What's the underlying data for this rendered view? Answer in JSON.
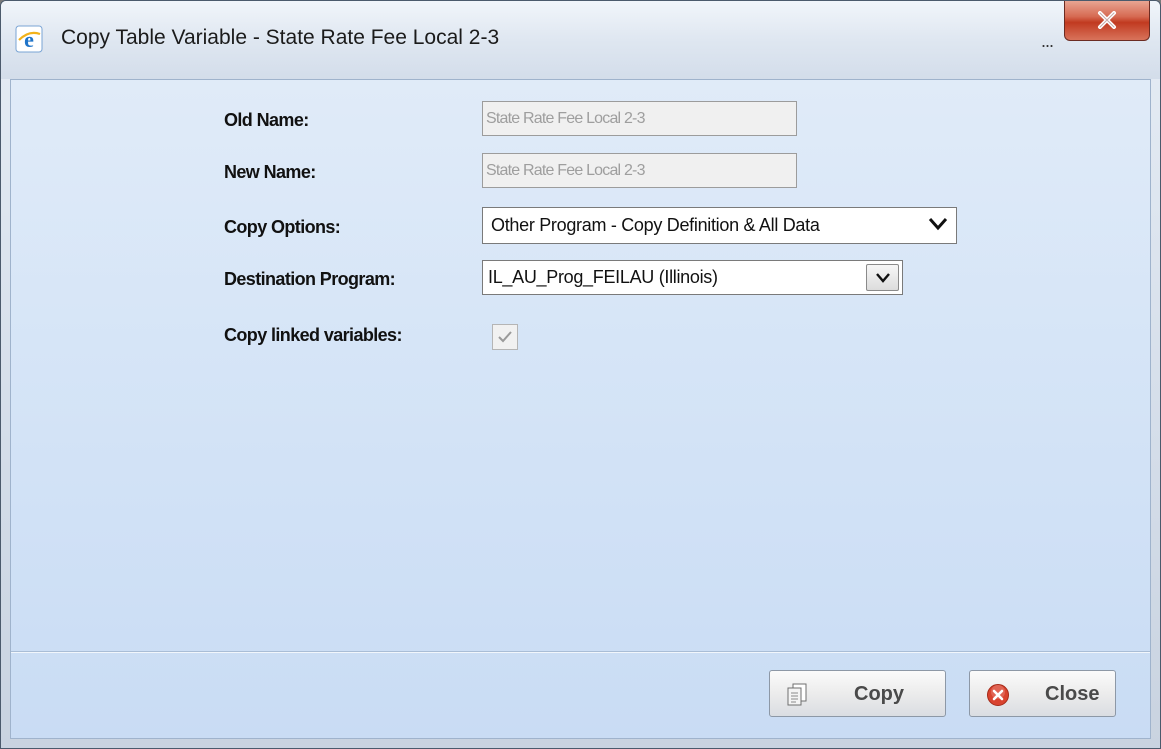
{
  "window": {
    "title": "Copy Table Variable - State Rate Fee Local 2-3",
    "ellipsis": "..."
  },
  "form": {
    "old_name": {
      "label": "Old Name:",
      "value": "State Rate Fee Local 2-3"
    },
    "new_name": {
      "label": "New Name:",
      "value": "State Rate Fee Local 2-3"
    },
    "copy_options": {
      "label": "Copy Options:",
      "selected": "Other Program - Copy Definition & All Data"
    },
    "destination_program": {
      "label": "Destination Program:",
      "selected": "IL_AU_Prog_FEILAU (Illinois)"
    },
    "copy_linked": {
      "label": "Copy linked variables:",
      "checked": true
    }
  },
  "buttons": {
    "copy_label": "Copy",
    "close_label": "Close"
  },
  "colors": {
    "close_icon_red": "#d9432f",
    "window_close_red": "#c13a20",
    "client_background": "#d6e5f7"
  },
  "icons": {
    "app": "internet-explorer-icon",
    "window_close": "close-x-icon",
    "copy": "copy-pages-icon",
    "close": "close-circle-icon",
    "dropdown": "chevron-down-icon",
    "check": "checkmark-icon"
  }
}
